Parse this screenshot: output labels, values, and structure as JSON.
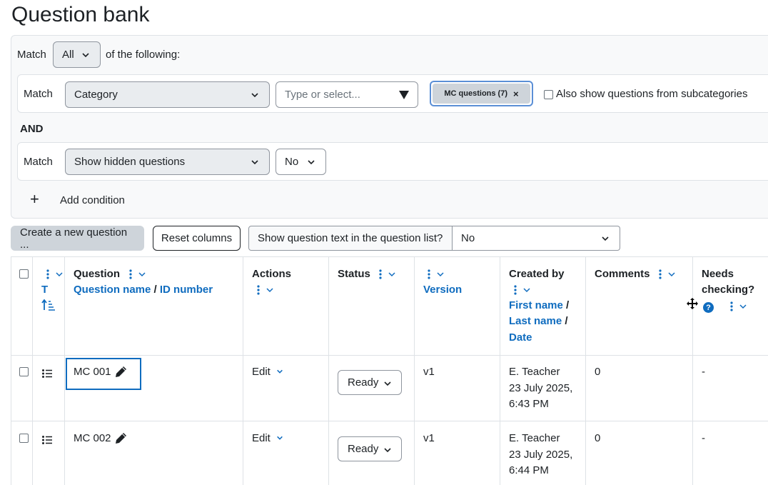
{
  "page": {
    "title": "Question bank"
  },
  "filters": {
    "match_label": "Match",
    "join_value": "All",
    "of_following": "of the following:",
    "category_condition": {
      "match_label": "Match",
      "type_value": "Category",
      "search_placeholder": "Type or select...",
      "selected_tag": "MC questions (7)",
      "tag_remove": "×",
      "subcategories_label": "Also show questions from subcategories"
    },
    "and_label": "AND",
    "hidden_condition": {
      "match_label": "Match",
      "type_value": "Show hidden questions",
      "value": "No"
    },
    "add_condition_label": "Add condition",
    "add_icon": "+"
  },
  "toolbar": {
    "create_label": "Create a new question ...",
    "reset_label": "Reset columns",
    "show_text_label": "Show question text in the question list?",
    "show_text_value": "No"
  },
  "table": {
    "headers": {
      "type_t": "T",
      "question": "Question",
      "question_name": "Question name",
      "slash": "/",
      "id_number": "ID number",
      "actions": "Actions",
      "status": "Status",
      "version": "Version",
      "created_by": "Created by",
      "first_name": "First name",
      "last_name": "Last name",
      "date": "Date",
      "comments": "Comments",
      "needs_checking_1": "Needs",
      "needs_checking_2": "checking?",
      "help_icon": "?"
    },
    "rows": [
      {
        "name": "MC 001",
        "action": "Edit",
        "status": "Ready",
        "version": "v1",
        "creator": "E. Teacher",
        "date_line1": "23 July 2025,",
        "date_line2": "6:43 PM",
        "comments": "0",
        "needs_checking": "-"
      },
      {
        "name": "MC 002",
        "action": "Edit",
        "status": "Ready",
        "version": "v1",
        "creator": "E. Teacher",
        "date_line1": "23 July 2025,",
        "date_line2": "6:44 PM",
        "comments": "0",
        "needs_checking": "-"
      }
    ]
  },
  "colors": {
    "link": "#0f6cbf",
    "border": "#dee2e6",
    "panel_bg": "#f8f9fa",
    "grey_button": "#ced4da"
  }
}
